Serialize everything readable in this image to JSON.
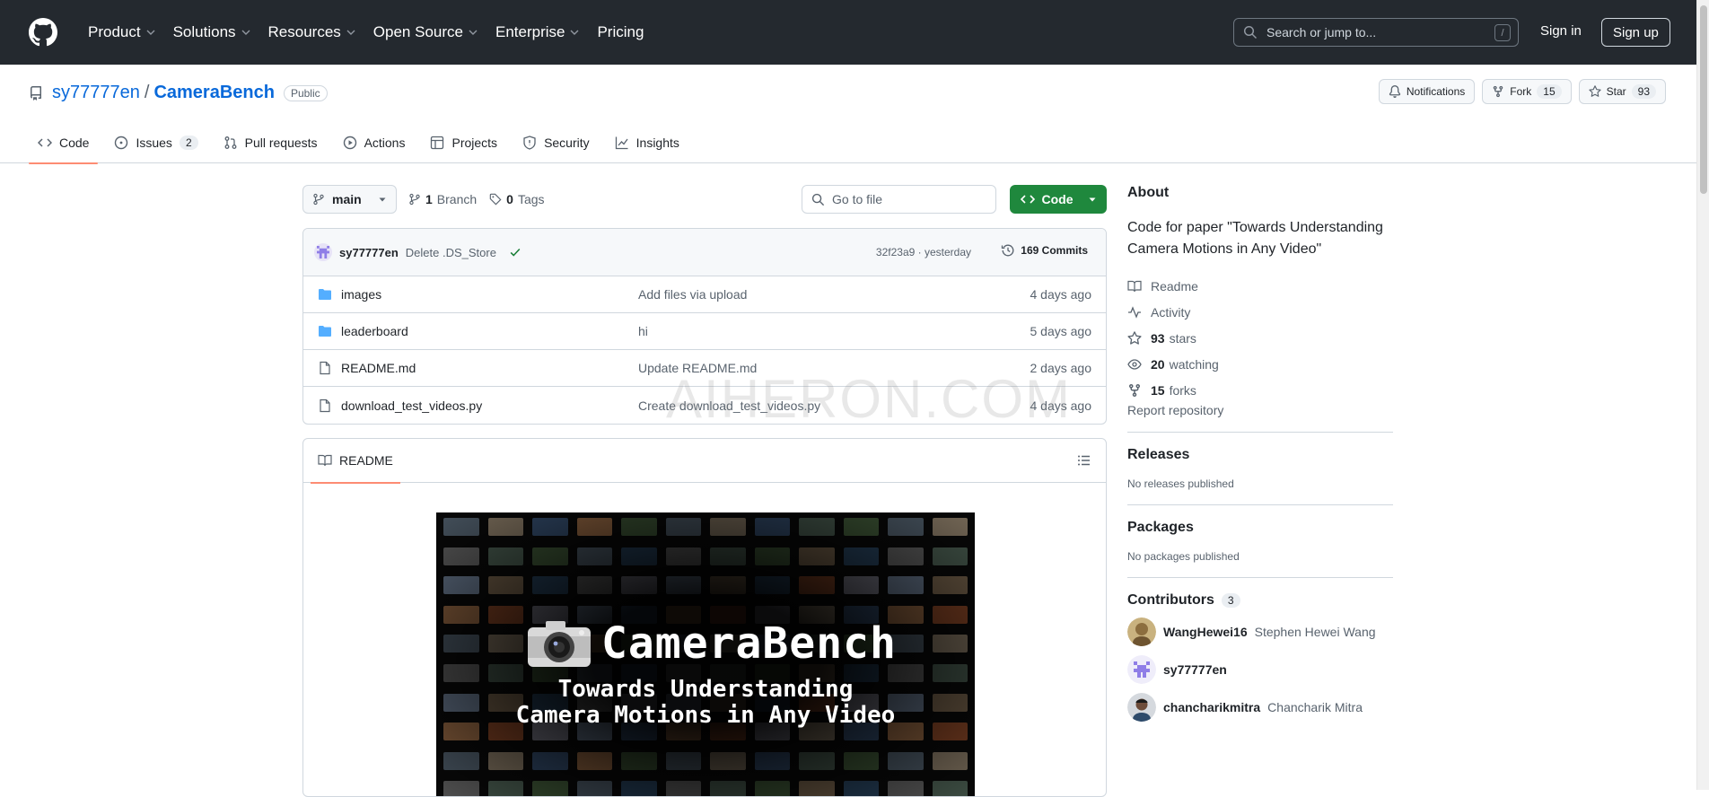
{
  "header": {
    "nav": [
      {
        "label": "Product",
        "dropdown": true
      },
      {
        "label": "Solutions",
        "dropdown": true
      },
      {
        "label": "Resources",
        "dropdown": true
      },
      {
        "label": "Open Source",
        "dropdown": true
      },
      {
        "label": "Enterprise",
        "dropdown": true
      },
      {
        "label": "Pricing",
        "dropdown": false
      }
    ],
    "search_placeholder": "Search or jump to...",
    "search_shortcut": "/",
    "sign_in": "Sign in",
    "sign_up": "Sign up"
  },
  "repo": {
    "owner": "sy77777en",
    "separator": "/",
    "name": "CameraBench",
    "visibility": "Public",
    "notifications_label": "Notifications",
    "fork_label": "Fork",
    "fork_count": "15",
    "star_label": "Star",
    "star_count": "93",
    "tabs": [
      {
        "label": "Code",
        "count": "",
        "icon": "code-icon"
      },
      {
        "label": "Issues",
        "count": "2",
        "icon": "issue-icon"
      },
      {
        "label": "Pull requests",
        "count": "",
        "icon": "pull-request-icon"
      },
      {
        "label": "Actions",
        "count": "",
        "icon": "play-icon"
      },
      {
        "label": "Projects",
        "count": "",
        "icon": "table-icon"
      },
      {
        "label": "Security",
        "count": "",
        "icon": "shield-icon"
      },
      {
        "label": "Insights",
        "count": "",
        "icon": "graph-icon"
      }
    ]
  },
  "filebar": {
    "branch": "main",
    "branch_count": "1",
    "branch_word": "Branch",
    "tag_count": "0",
    "tag_word": "Tags",
    "goto_placeholder": "Go to file",
    "code_button": "Code"
  },
  "commit": {
    "author": "sy77777en",
    "message": "Delete .DS_Store",
    "hash_time": "32f23a9 · yesterday",
    "commits": "169 Commits"
  },
  "files": [
    {
      "type": "folder",
      "name": "images",
      "message": "Add files via upload",
      "date": "4 days ago"
    },
    {
      "type": "folder",
      "name": "leaderboard",
      "message": "hi",
      "date": "5 days ago"
    },
    {
      "type": "file",
      "name": "README.md",
      "message": "Update README.md",
      "date": "2 days ago"
    },
    {
      "type": "file",
      "name": "download_test_videos.py",
      "message": "Create download_test_videos.py",
      "date": "4 days ago"
    }
  ],
  "readme": {
    "tab_label": "README",
    "banner_title": "CameraBench",
    "banner_line1": "Towards Understanding",
    "banner_line2": "Camera Motions in Any Video"
  },
  "watermark": "AIHERON.COM",
  "about": {
    "heading": "About",
    "description": "Code for paper \"Towards Understanding Camera Motions in Any Video\"",
    "readme": "Readme",
    "activity": "Activity",
    "stars_num": "93",
    "stars_word": "stars",
    "watching_num": "20",
    "watching_word": "watching",
    "forks_num": "15",
    "forks_word": "forks",
    "report": "Report repository"
  },
  "releases": {
    "heading": "Releases",
    "note": "No releases published"
  },
  "packages": {
    "heading": "Packages",
    "note": "No packages published"
  },
  "contributors": {
    "heading": "Contributors",
    "count": "3",
    "list": [
      {
        "login": "WangHewei16",
        "name": "Stephen Hewei Wang"
      },
      {
        "login": "sy77777en",
        "name": ""
      },
      {
        "login": "chancharikmitra",
        "name": "Chancharik Mitra"
      }
    ]
  },
  "colors": {
    "header_bg": "#24292f",
    "link": "#0969da",
    "primary_button": "#1f883d",
    "tab_underline": "#fd8c73"
  }
}
